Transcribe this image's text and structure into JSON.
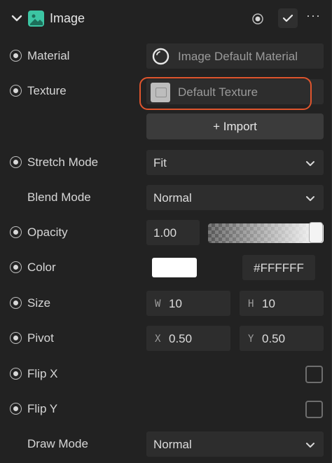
{
  "component": {
    "title": "Image",
    "icons": {
      "collapse": "chevron-down-icon",
      "component": "image-icon",
      "target": "target-icon",
      "enabled": "check-icon",
      "more": "more-icon"
    }
  },
  "properties": {
    "material": {
      "label": "Material",
      "value": "Image Default Material"
    },
    "texture": {
      "label": "Texture",
      "value": "Default Texture",
      "import_label": "+ Import"
    },
    "stretch_mode": {
      "label": "Stretch Mode",
      "value": "Fit"
    },
    "blend_mode": {
      "label": "Blend Mode",
      "value": "Normal"
    },
    "opacity": {
      "label": "Opacity",
      "value": "1.00",
      "level": 1.0
    },
    "color": {
      "label": "Color",
      "swatch": "#FFFFFF",
      "hex": "#FFFFFF"
    },
    "size": {
      "label": "Size",
      "w_axis": "W",
      "w": "10",
      "h_axis": "H",
      "h": "10"
    },
    "pivot": {
      "label": "Pivot",
      "x_axis": "X",
      "x": "0.50",
      "y_axis": "Y",
      "y": "0.50"
    },
    "flip_x": {
      "label": "Flip X",
      "checked": false
    },
    "flip_y": {
      "label": "Flip Y",
      "checked": false
    },
    "draw_mode": {
      "label": "Draw Mode",
      "value": "Normal"
    }
  },
  "colors": {
    "background": "#222222",
    "field": "#2d2d2d",
    "highlight": "#e0552d",
    "accent": "#3cc5a3"
  }
}
